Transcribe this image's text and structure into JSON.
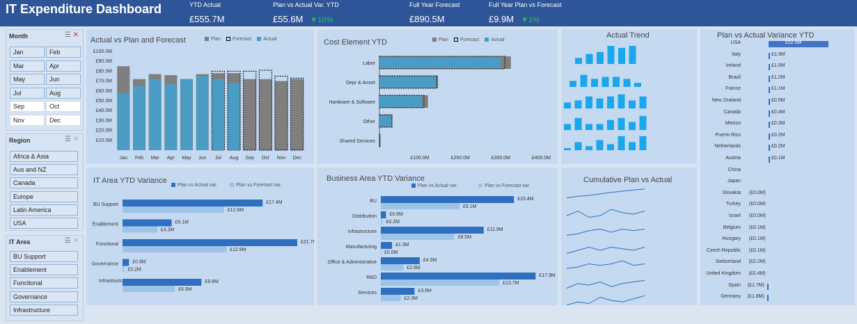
{
  "header": {
    "title": "IT Expenditure Dashboard",
    "kpis": [
      {
        "label": "YTD Actual",
        "value": "£555.7M",
        "change": ""
      },
      {
        "label": "Plan vs Actual Var. YTD",
        "value": "£55.6M",
        "change": "▼10%"
      },
      {
        "label": "Full Year Forecast",
        "value": "£890.5M",
        "change": ""
      },
      {
        "label": "Full Year Plan vs Forecast",
        "value": "£9.9M",
        "change": "▼1%"
      }
    ]
  },
  "slicers": {
    "month": {
      "title": "Month",
      "items": [
        "Jan",
        "Feb",
        "Mar",
        "Apr",
        "May",
        "Jun",
        "Jul",
        "Aug",
        "Sep",
        "Oct",
        "Nov",
        "Dec"
      ],
      "selected_count": 8
    },
    "region": {
      "title": "Region",
      "items": [
        "Africa & Asia",
        "Aus and NZ",
        "Canada",
        "Europe",
        "Latin America",
        "USA"
      ]
    },
    "it_area": {
      "title": "IT Area",
      "items": [
        "BU Support",
        "Enablement",
        "Functional",
        "Governance",
        "Infrastructure"
      ]
    }
  },
  "colors": {
    "actual": "#4a9cc4",
    "plan": "#7f7f7f",
    "forecast": "#7f7f7f",
    "dark_blue": "#2e6fc0",
    "light_blue": "#9dc3e6",
    "trend": "#1aa7ec"
  },
  "chart_data": [
    {
      "type": "bar",
      "title": "Actual vs Plan and Forecast",
      "legend": [
        "Plan",
        "Forecast",
        "Actual"
      ],
      "categories": [
        "Jan",
        "Feb",
        "Mar",
        "Apr",
        "May",
        "Jun",
        "Jul",
        "Aug",
        "Sep",
        "Oct",
        "Nov",
        "Dec"
      ],
      "yticks": [
        "£100.0M",
        "£90.0M",
        "£80.0M",
        "£70.0M",
        "£60.0M",
        "£50.0M",
        "£40.0M",
        "£30.0M",
        "£20.0M",
        "£10.0M"
      ],
      "ylim": [
        0,
        100
      ],
      "series": [
        {
          "name": "Actual",
          "values": [
            58,
            65,
            72,
            67,
            72,
            75,
            72,
            68,
            null,
            null,
            null,
            null
          ]
        },
        {
          "name": "Plan",
          "values": [
            85,
            72,
            77,
            76,
            72,
            77,
            78,
            78,
            72,
            72,
            70,
            72
          ]
        },
        {
          "name": "Forecast",
          "values": [
            null,
            null,
            null,
            null,
            null,
            null,
            80,
            80,
            80,
            81,
            75,
            73
          ]
        }
      ]
    },
    {
      "type": "bar",
      "title": "Cost Element YTD",
      "legend": [
        "Plan",
        "Forecast",
        "Actual"
      ],
      "categories": [
        "Labor",
        "Depr & Amort",
        "Hardware & Software",
        "Other",
        "Shared Services"
      ],
      "xticks": [
        "£100.0M",
        "£200.0M",
        "£300.0M",
        "£400.0M"
      ],
      "xlim": [
        0,
        420
      ],
      "series": [
        {
          "name": "Actual",
          "values": [
            300,
            140,
            105,
            30,
            0
          ]
        },
        {
          "name": "Plan",
          "values": [
            325,
            145,
            120,
            32,
            0
          ]
        },
        {
          "name": "Forecast",
          "values": [
            310,
            142,
            110,
            31,
            1
          ]
        }
      ]
    },
    {
      "type": "bar",
      "title": "IT Area YTD Variance",
      "legend": [
        "Plan vs Actual var.",
        "Plan vs Forecast var."
      ],
      "categories": [
        "BU Support",
        "Enablement",
        "Functional",
        "Governance",
        "Infrastructure"
      ],
      "xlim": [
        0,
        23
      ],
      "series": [
        {
          "name": "Plan vs Actual var.",
          "values": [
            17.4,
            6.1,
            21.7,
            0.8,
            9.8
          ],
          "labels": [
            "£17.4M",
            "£6.1M",
            "£21.7M",
            "£0.8M",
            "£9.8M"
          ]
        },
        {
          "name": "Plan vs Forecast var.",
          "values": [
            12.6,
            4.3,
            12.9,
            0.2,
            6.5
          ],
          "labels": [
            "£12.6M",
            "£4.3M",
            "£12.9M",
            "£0.2M",
            "£6.5M"
          ]
        }
      ]
    },
    {
      "type": "bar",
      "title": "Business Area YTD Variance",
      "legend": [
        "Plan vs Actual var.",
        "Plan vs Forecast var."
      ],
      "categories": [
        "BU",
        "Distribution",
        "Infrastructure",
        "Manufacturing",
        "Office & Administrative",
        "R&D",
        "Services"
      ],
      "xlim": [
        0,
        19
      ],
      "series": [
        {
          "name": "Plan vs Actual var.",
          "values": [
            15.4,
            0.6,
            11.9,
            1.3,
            4.5,
            17.9,
            3.9
          ],
          "labels": [
            "£15.4M",
            "£0.6M",
            "£11.9M",
            "£1.3M",
            "£4.5M",
            "£17.9M",
            "£3.9M"
          ]
        },
        {
          "name": "Plan vs Forecast var.",
          "values": [
            9.1,
            0.2,
            8.5,
            0.0,
            2.6,
            13.7,
            2.3
          ],
          "labels": [
            "£9.1M",
            "£0.2M",
            "£8.5M",
            "£0.0M",
            "£2.6M",
            "£13.7M",
            "£2.3M"
          ]
        }
      ]
    },
    {
      "type": "bar",
      "title": "Actual Trend",
      "series": [
        {
          "values": [
            3,
            5,
            6,
            9,
            8,
            9
          ]
        },
        {
          "values": [
            3,
            6,
            4,
            5,
            5,
            4,
            2
          ]
        },
        {
          "values": [
            3,
            4,
            6,
            5,
            6,
            7,
            4,
            6
          ]
        },
        {
          "values": [
            3,
            6,
            3,
            3,
            5,
            6,
            4,
            7
          ]
        },
        {
          "values": [
            1,
            4,
            2,
            5,
            3,
            7,
            4,
            7
          ]
        }
      ]
    },
    {
      "type": "line",
      "title": "Cumulative Plan vs Actual",
      "series": [
        {
          "values": [
            2,
            3,
            3.5,
            4.5,
            5.5,
            6.2,
            7,
            7.6
          ]
        },
        {
          "values": [
            3,
            6,
            2,
            3,
            7,
            5,
            4,
            6
          ]
        },
        {
          "values": [
            2,
            3,
            5,
            6,
            4,
            6,
            5,
            6
          ]
        },
        {
          "values": [
            2,
            4,
            6,
            4,
            6,
            5,
            4,
            6
          ]
        },
        {
          "values": [
            3,
            4,
            6,
            5,
            6,
            8,
            5,
            6
          ]
        },
        {
          "values": [
            2,
            5,
            4,
            6,
            3,
            5,
            6,
            7
          ]
        },
        {
          "values": [
            1,
            3,
            2,
            6,
            4,
            3,
            5,
            7
          ]
        }
      ]
    },
    {
      "type": "bar",
      "title": "Plan vs Actual Variance YTD",
      "categories": [
        "USA",
        "Italy",
        "Ireland",
        "Brazil",
        "France",
        "New Zealand",
        "Canada",
        "Mexico",
        "Puerto Rico",
        "Netherlands",
        "Austria",
        "China",
        "Japan",
        "Slovakia",
        "Turkey",
        "Israel",
        "Belgium",
        "Hungary",
        "Czech Republic",
        "Switzerland",
        "United Kingdom",
        "Spain",
        "Germany"
      ],
      "values": [
        52.9,
        1.9,
        1.5,
        1.2,
        1.1,
        0.5,
        0.4,
        0.3,
        0.2,
        0.2,
        0.1,
        0,
        0,
        -0.0,
        -0.0,
        -0.0,
        -0.1,
        -0.1,
        -0.1,
        -0.2,
        -0.4,
        -1.7,
        -1.8
      ],
      "labels": [
        "£52.9M",
        "£1.9M",
        "£1.5M",
        "£1.2M",
        "£1.1M",
        "£0.5M",
        "£0.4M",
        "£0.3M",
        "£0.2M",
        "£0.2M",
        "£0.1M",
        "",
        "",
        "(£0.0M)",
        "(£0.0M)",
        "(£0.0M)",
        "(£0.1M)",
        "(£0.1M)",
        "(£0.1M)",
        "(£0.2M)",
        "(£0.4M)",
        "(£1.7M)",
        "(£1.8M)"
      ]
    }
  ]
}
